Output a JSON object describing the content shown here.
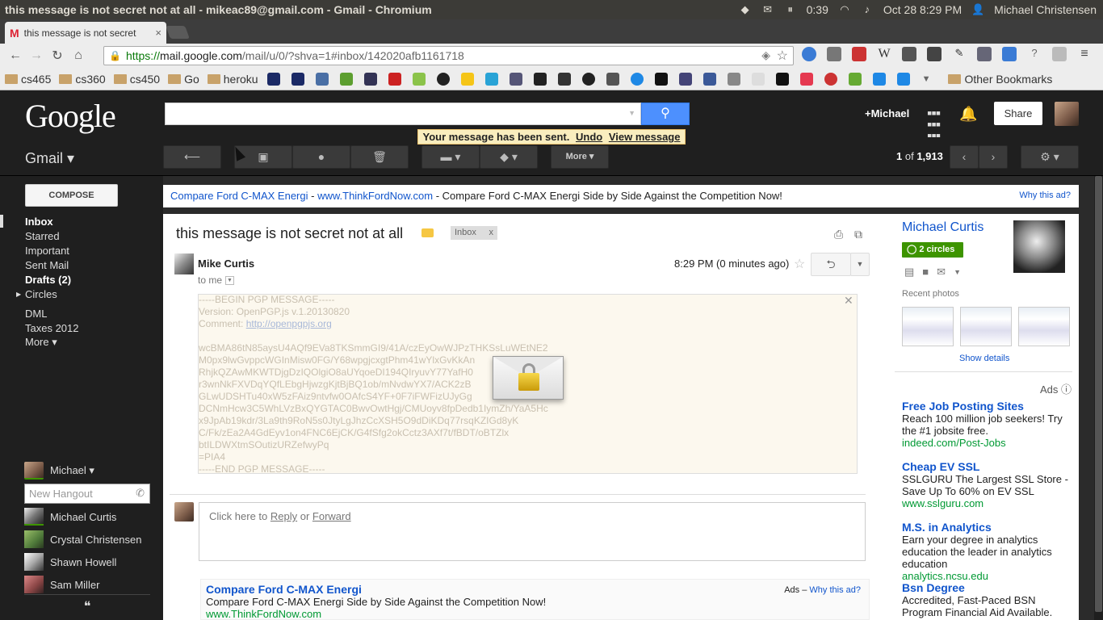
{
  "os": {
    "window_title": "this message is not secret not at all - mikeac89@gmail.com - Gmail - Chromium",
    "time": "0:39",
    "datetime": "Oct 28  8:29 PM",
    "user": "Michael Christensen"
  },
  "browser": {
    "tab_title": "this message is not secret",
    "tab_close": "×",
    "url_https": "https://",
    "url_host": "mail.google.com",
    "url_rest": "/mail/u/0/?shva=1#inbox/142020afb1161718",
    "bookmarks": [
      "cs465",
      "cs360",
      "cs450",
      "Go",
      "heroku"
    ],
    "other_bookmarks": "Other Bookmarks"
  },
  "gmail": {
    "logo": "Google",
    "plus_user": "+Michael",
    "share_label": "Share",
    "gmail_label": "Gmail ▾",
    "more_label": "More ▾",
    "notice": {
      "text": "Your message has been sent.",
      "undo": "Undo",
      "view": "View message"
    },
    "count": {
      "range": "1",
      "of": "of",
      "total": "1,913"
    },
    "compose_label": "COMPOSE",
    "nav": {
      "inbox": "Inbox",
      "starred": "Starred",
      "important": "Important",
      "sent": "Sent Mail",
      "drafts": "Drafts (2)",
      "circles": "Circles",
      "dml": "DML",
      "taxes": "Taxes 2012",
      "more": "More ▾"
    },
    "hangouts": {
      "me": "Michael ▾",
      "placeholder": "New Hangout",
      "contacts": [
        "Michael Curtis",
        "Crystal Christensen",
        "Shawn Howell",
        "Sam Miller"
      ]
    },
    "top_ad": {
      "title": "Compare Ford C-MAX Energi",
      "dash1": " - ",
      "url": "www.ThinkFordNow.com",
      "dash2": " - ",
      "desc": "Compare Ford C-MAX Energi Side by Side Against the Competition Now!",
      "why": "Why this ad?"
    },
    "message": {
      "subject": "this message is not secret not at all",
      "label": "Inbox",
      "label_x": "x",
      "sender": "Mike Curtis",
      "to": "to me",
      "time": "8:29 PM (0 minutes ago)",
      "pgp": {
        "begin": "-----BEGIN PGP MESSAGE-----",
        "version": "Version: OpenPGP.js v.1.20130820",
        "comment_label": "Comment: ",
        "comment_link": "http://openpgpjs.org",
        "lines": [
          "wcBMA86tN85aysU4AQf9EVa8TKSmmGI9/41A/czEyOwWJPzTHKSsLuWEtNE2",
          "M0px9lwGvppcWGInMisw0FG/Y68wpgjcxgtPhm41wYlxGvKkAn",
          "RhjkQZAwMKWTDjgDzIQOlgiO8aUYqoeDI194QIryuvY77YafH0",
          "r3wnNkFXVDqYQfLEbgHjwzgKjtBjBQ1ob/mNvdwYX7/ACK2zB",
          "GLwUDSHTu40xW5zFAiz9ntvfw0OAfcS4YF+0F7iFWFizUJyGg",
          "DCNmHcw3C5WhLVzBxQYGTAC0BwvOwtHgj/CMUoyv8fpDedb1IymZh/YaA5Hc",
          "x9JpAb19kdr/3La9th9RoN5s0JtyLgJhzCcXSH5O9dDiKDq77rsqKZIGd8yK",
          "C/Fk/zEa2A4GdEyv1on4FNC6EjCK/G4fSfg2okCctz3AXf7t/fBDT/oBTZlx",
          "btILDWXtmSOutizURZefwyPq",
          "=PIA4"
        ],
        "end": "-----END PGP MESSAGE-----"
      },
      "reply_prompt": "Click here to ",
      "reply_link": "Reply",
      "or": " or ",
      "forward_link": "Forward"
    },
    "bottom_ad": {
      "title": "Compare Ford C-MAX Energi",
      "desc": "Compare Ford C-MAX Energi Side by Side Against the Competition Now!",
      "url": "www.ThinkFordNow.com",
      "ads_label": "Ads – ",
      "why": "Why this ad?"
    },
    "profile": {
      "name": "Michael Curtis",
      "circles": "2 circles",
      "recent_photos": "Recent photos",
      "show_details": "Show details"
    },
    "side_ads": {
      "label": "Ads ⓘ",
      "items": [
        {
          "title": "Free Job Posting Sites",
          "desc": "Reach 100 million job seekers! Try the #1 jobsite free.",
          "url": "indeed.com/Post-Jobs"
        },
        {
          "title": "Cheap EV SSL",
          "desc": "SSLGURU The Largest SSL Store - Save Up To 60% on EV SSL",
          "url": "www.sslguru.com"
        },
        {
          "title": "M.S. in Analytics",
          "desc": "Earn your degree in analytics education the leader in analytics education",
          "url": "analytics.ncsu.edu"
        },
        {
          "title": "Bsn Degree",
          "desc": "Accredited, Fast-Paced BSN Program Financial Aid Available.",
          "url": ""
        }
      ]
    }
  }
}
